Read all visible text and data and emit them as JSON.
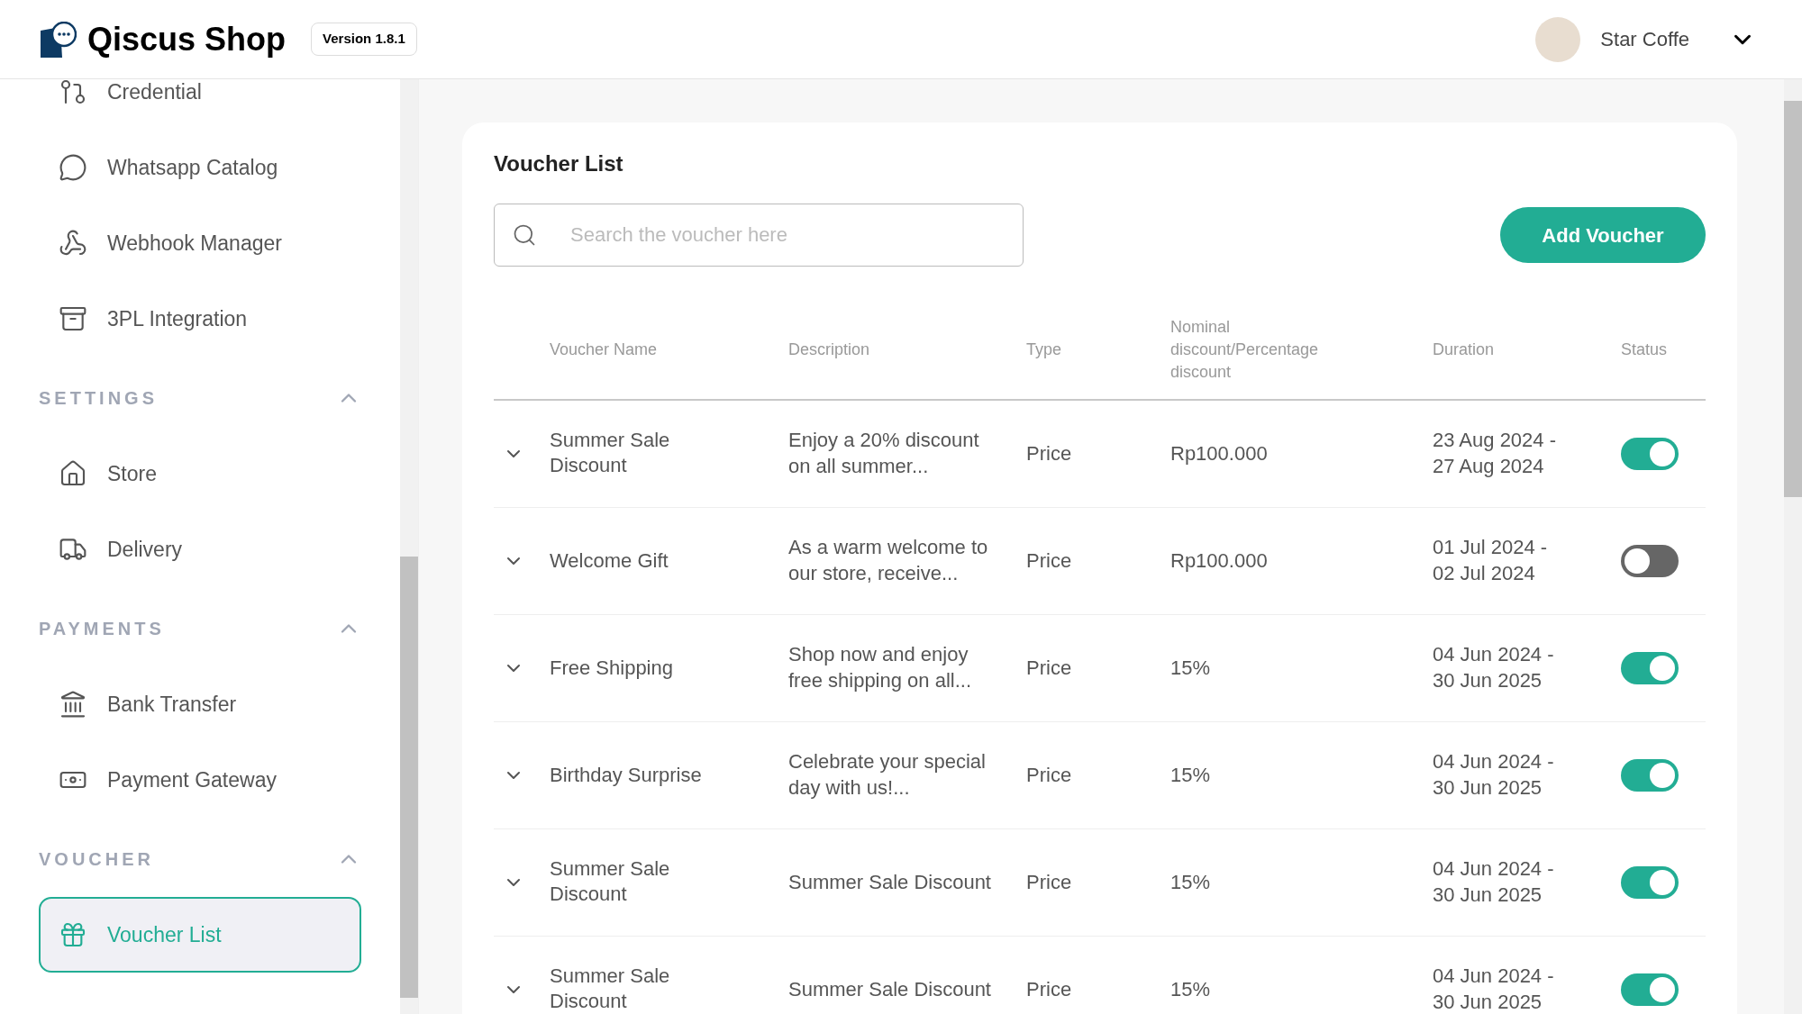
{
  "header": {
    "brand": "Qiscus Shop",
    "version": "Version 1.8.1",
    "user": "Star Coffe"
  },
  "sidebar": {
    "items": [
      {
        "kind": "credential",
        "label": "Credential",
        "selected": false
      },
      {
        "kind": "whatsapp",
        "label": "Whatsapp Catalog",
        "selected": false
      },
      {
        "kind": "webhook",
        "label": "Webhook Manager",
        "selected": false
      },
      {
        "kind": "archive",
        "label": "3PL Integration",
        "selected": false
      }
    ],
    "sections": [
      {
        "title": "SETTINGS",
        "expanded": true,
        "items": [
          {
            "kind": "store",
            "label": "Store",
            "selected": false
          },
          {
            "kind": "delivery",
            "label": "Delivery",
            "selected": false
          }
        ]
      },
      {
        "title": "PAYMENTS",
        "expanded": true,
        "items": [
          {
            "kind": "bank",
            "label": "Bank Transfer",
            "selected": false
          },
          {
            "kind": "payment",
            "label": "Payment Gateway",
            "selected": false
          }
        ]
      },
      {
        "title": "VOUCHER",
        "expanded": true,
        "items": [
          {
            "kind": "gift",
            "label": "Voucher List",
            "selected": true
          }
        ]
      }
    ]
  },
  "content": {
    "title": "Voucher List",
    "search": {
      "placeholder": "Search the voucher here"
    },
    "add_button": "Add Voucher",
    "table": {
      "columns": [
        "Voucher Name",
        "Description",
        "Type",
        "Nominal discount/Percentage discount",
        "Duration",
        "Status"
      ],
      "rows": [
        {
          "name": "Summer Sale Discount",
          "description": "Enjoy a 20% discount on all summer...",
          "type": "Price",
          "discount": "Rp100.000",
          "duration": "23 Aug 2024 - 27 Aug 2024",
          "active": true
        },
        {
          "name": "Welcome Gift",
          "description": "As a warm welcome to our store, receive...",
          "type": "Price",
          "discount": "Rp100.000",
          "duration": "01 Jul 2024 - 02 Jul 2024",
          "active": false
        },
        {
          "name": "Free Shipping",
          "description": "Shop now and enjoy free shipping on all...",
          "type": "Price",
          "discount": "15%",
          "duration": "04 Jun 2024 - 30 Jun 2025",
          "active": true
        },
        {
          "name": "Birthday Surprise",
          "description": "Celebrate your special day with us!...",
          "type": "Price",
          "discount": "15%",
          "duration": "04 Jun 2024 - 30 Jun 2025",
          "active": true
        },
        {
          "name": "Summer Sale Discount",
          "description": "Summer Sale Discount",
          "type": "Price",
          "discount": "15%",
          "duration": "04 Jun 2024 - 30 Jun 2025",
          "active": true
        },
        {
          "name": "Summer Sale Discount",
          "description": "Summer Sale Discount",
          "type": "Price",
          "discount": "15%",
          "duration": "04 Jun 2024 - 30 Jun 2025",
          "active": true
        }
      ]
    }
  }
}
